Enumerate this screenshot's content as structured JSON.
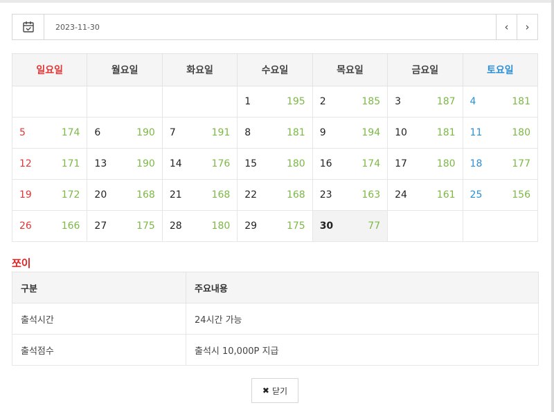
{
  "date_bar": {
    "date_value": "2023-11-30",
    "prev_label": "‹",
    "next_label": "›"
  },
  "calendar": {
    "weekdays": [
      "일요일",
      "월요일",
      "화요일",
      "수요일",
      "목요일",
      "금요일",
      "토요일"
    ],
    "weeks": [
      [
        null,
        null,
        null,
        {
          "day": "1",
          "count": "195"
        },
        {
          "day": "2",
          "count": "185"
        },
        {
          "day": "3",
          "count": "187"
        },
        {
          "day": "4",
          "count": "181"
        }
      ],
      [
        {
          "day": "5",
          "count": "174"
        },
        {
          "day": "6",
          "count": "190"
        },
        {
          "day": "7",
          "count": "191"
        },
        {
          "day": "8",
          "count": "181"
        },
        {
          "day": "9",
          "count": "194"
        },
        {
          "day": "10",
          "count": "181"
        },
        {
          "day": "11",
          "count": "180"
        }
      ],
      [
        {
          "day": "12",
          "count": "171"
        },
        {
          "day": "13",
          "count": "190"
        },
        {
          "day": "14",
          "count": "176"
        },
        {
          "day": "15",
          "count": "180"
        },
        {
          "day": "16",
          "count": "174"
        },
        {
          "day": "17",
          "count": "180"
        },
        {
          "day": "18",
          "count": "177"
        }
      ],
      [
        {
          "day": "19",
          "count": "172"
        },
        {
          "day": "20",
          "count": "168"
        },
        {
          "day": "21",
          "count": "168"
        },
        {
          "day": "22",
          "count": "168"
        },
        {
          "day": "23",
          "count": "163"
        },
        {
          "day": "24",
          "count": "161"
        },
        {
          "day": "25",
          "count": "156"
        }
      ],
      [
        {
          "day": "26",
          "count": "166"
        },
        {
          "day": "27",
          "count": "175"
        },
        {
          "day": "28",
          "count": "180"
        },
        {
          "day": "29",
          "count": "175"
        },
        {
          "day": "30",
          "count": "77",
          "today": true
        },
        null,
        null
      ]
    ]
  },
  "section_title": "쪼이",
  "info_table": {
    "headers": [
      "구분",
      "주요내용"
    ],
    "rows": [
      [
        "출석시간",
        "24시간 가능"
      ],
      [
        "출석점수",
        "출석시 10,000P 지급"
      ]
    ]
  },
  "close_button": {
    "icon": "✖",
    "label": "닫기"
  },
  "colors": {
    "sunday": "#e43535",
    "saturday": "#2b8fd6",
    "count": "#7bb844",
    "section_title": "#e02020"
  }
}
